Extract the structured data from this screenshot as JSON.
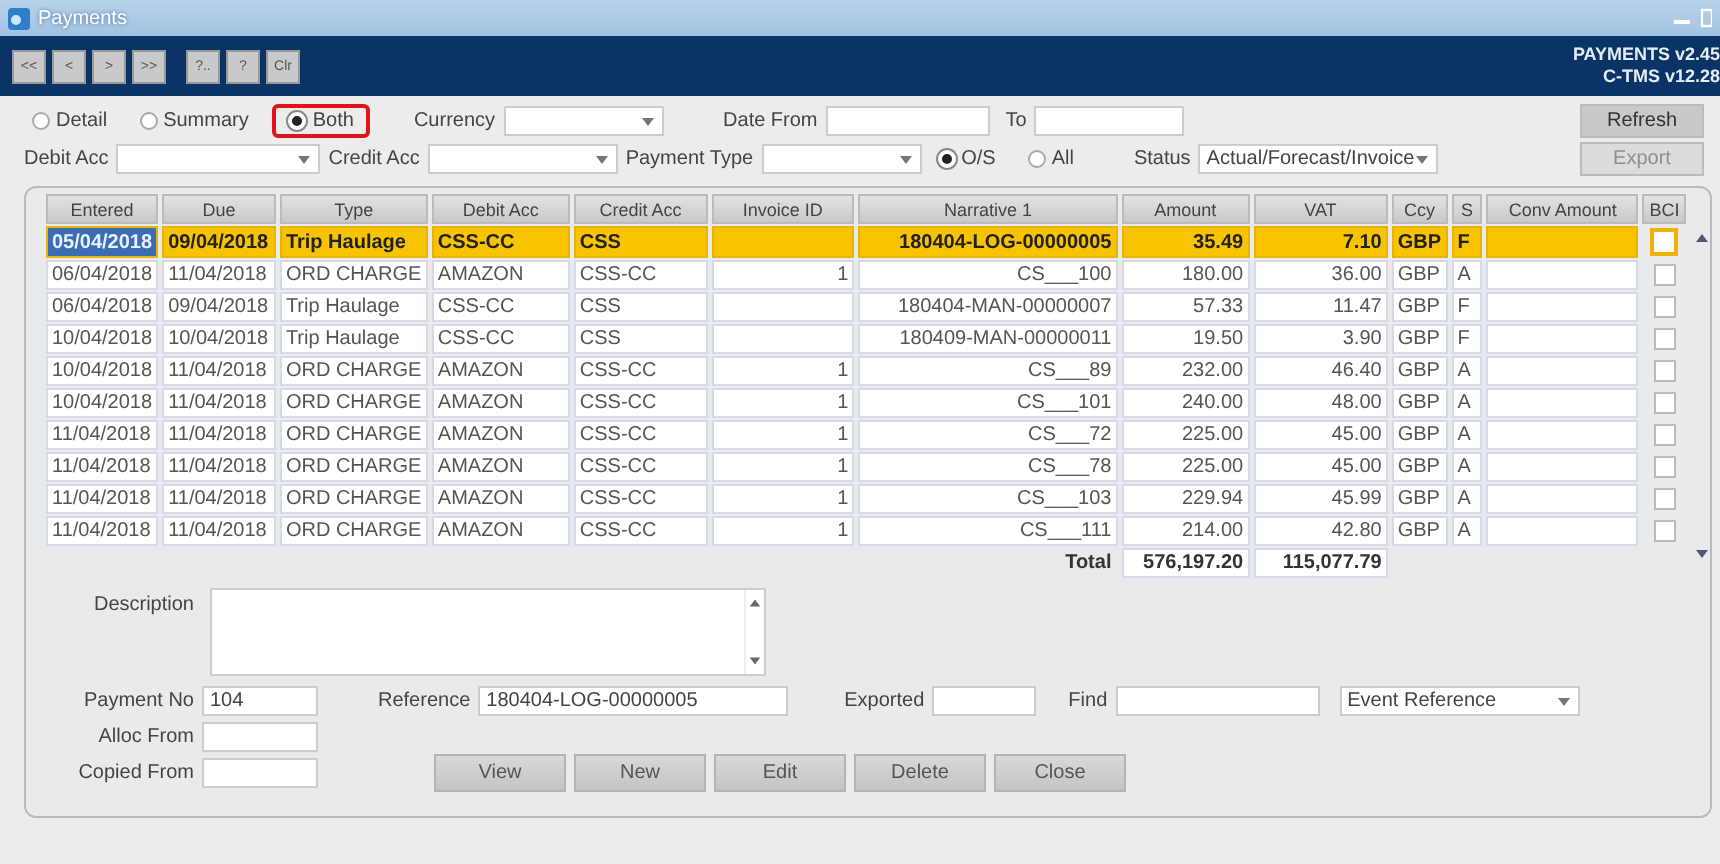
{
  "window": {
    "title": "Payments",
    "version_lines": [
      "PAYMENTS v2.45",
      "C-TMS v12.28"
    ]
  },
  "toolbar": {
    "buttons": [
      "<<",
      "<",
      ">",
      ">>",
      "?..",
      "?",
      "Clr"
    ]
  },
  "filters": {
    "view_modes": [
      {
        "label": "Detail",
        "selected": false,
        "highlighted": false
      },
      {
        "label": "Summary",
        "selected": false,
        "highlighted": false
      },
      {
        "label": "Both",
        "selected": true,
        "highlighted": true
      }
    ],
    "currency": {
      "label": "Currency"
    },
    "date_from": {
      "label": "Date From"
    },
    "date_to": {
      "label": "To"
    },
    "debit_acc": {
      "label": "Debit Acc"
    },
    "credit_acc": {
      "label": "Credit Acc"
    },
    "payment_type": {
      "label": "Payment Type"
    },
    "outstanding": [
      {
        "label": "O/S",
        "selected": true
      },
      {
        "label": "All",
        "selected": false
      }
    ],
    "status": {
      "label": "Status",
      "value": "Actual/Forecast/Invoice"
    },
    "buttons": [
      {
        "label": "Refresh",
        "disabled": false
      },
      {
        "label": "Export",
        "disabled": true
      }
    ]
  },
  "table": {
    "columns": [
      "Entered",
      "Due",
      "Type",
      "Debit Acc",
      "Credit Acc",
      "Invoice ID",
      "Narrative 1",
      "Amount",
      "VAT",
      "Ccy",
      "S",
      "Conv Amount",
      "BCI"
    ],
    "rows": [
      {
        "selected": true,
        "entered": "05/04/2018",
        "due": "09/04/2018",
        "type": "Trip Haulage",
        "debit_acc": "CSS-CC",
        "credit_acc": "CSS",
        "narrative": "180404-LOG-00000005",
        "amount": "35.49",
        "vat": "7.10",
        "ccy": "GBP",
        "s": "F",
        "bci_checked": false
      },
      {
        "selected": false,
        "entered": "06/04/2018",
        "due": "11/04/2018",
        "type": "ORD CHARGE",
        "debit_acc": "AMAZON",
        "credit_acc": "CSS-CC",
        "invoice_id": "1",
        "narrative": "CS___100",
        "amount": "180.00",
        "vat": "36.00",
        "ccy": "GBP",
        "s": "A",
        "bci_checked": false
      },
      {
        "selected": false,
        "entered": "06/04/2018",
        "due": "09/04/2018",
        "type": "Trip Haulage",
        "debit_acc": "CSS-CC",
        "credit_acc": "CSS",
        "narrative": "180404-MAN-00000007",
        "amount": "57.33",
        "vat": "11.47",
        "ccy": "GBP",
        "s": "F",
        "bci_checked": false
      },
      {
        "selected": false,
        "entered": "10/04/2018",
        "due": "10/04/2018",
        "type": "Trip Haulage",
        "debit_acc": "CSS-CC",
        "credit_acc": "CSS",
        "narrative": "180409-MAN-00000011",
        "amount": "19.50",
        "vat": "3.90",
        "ccy": "GBP",
        "s": "F",
        "bci_checked": false
      },
      {
        "selected": false,
        "entered": "10/04/2018",
        "due": "11/04/2018",
        "type": "ORD CHARGE",
        "debit_acc": "AMAZON",
        "credit_acc": "CSS-CC",
        "invoice_id": "1",
        "narrative": "CS___89",
        "amount": "232.00",
        "vat": "46.40",
        "ccy": "GBP",
        "s": "A",
        "bci_checked": false
      },
      {
        "selected": false,
        "entered": "10/04/2018",
        "due": "11/04/2018",
        "type": "ORD CHARGE",
        "debit_acc": "AMAZON",
        "credit_acc": "CSS-CC",
        "invoice_id": "1",
        "narrative": "CS___101",
        "amount": "240.00",
        "vat": "48.00",
        "ccy": "GBP",
        "s": "A",
        "bci_checked": false
      },
      {
        "selected": false,
        "entered": "11/04/2018",
        "due": "11/04/2018",
        "type": "ORD CHARGE",
        "debit_acc": "AMAZON",
        "credit_acc": "CSS-CC",
        "invoice_id": "1",
        "narrative": "CS___72",
        "amount": "225.00",
        "vat": "45.00",
        "ccy": "GBP",
        "s": "A",
        "bci_checked": false
      },
      {
        "selected": false,
        "entered": "11/04/2018",
        "due": "11/04/2018",
        "type": "ORD CHARGE",
        "debit_acc": "AMAZON",
        "credit_acc": "CSS-CC",
        "invoice_id": "1",
        "narrative": "CS___78",
        "amount": "225.00",
        "vat": "45.00",
        "ccy": "GBP",
        "s": "A",
        "bci_checked": false
      },
      {
        "selected": false,
        "entered": "11/04/2018",
        "due": "11/04/2018",
        "type": "ORD CHARGE",
        "debit_acc": "AMAZON",
        "credit_acc": "CSS-CC",
        "invoice_id": "1",
        "narrative": "CS___103",
        "amount": "229.94",
        "vat": "45.99",
        "ccy": "GBP",
        "s": "A",
        "bci_checked": false
      },
      {
        "selected": false,
        "entered": "11/04/2018",
        "due": "11/04/2018",
        "type": "ORD CHARGE",
        "debit_acc": "AMAZON",
        "credit_acc": "CSS-CC",
        "invoice_id": "1",
        "narrative": "CS___111",
        "amount": "214.00",
        "vat": "42.80",
        "ccy": "GBP",
        "s": "A",
        "bci_checked": false
      }
    ],
    "totals": {
      "label": "Total",
      "amount": "576,197.20",
      "vat": "115,077.79"
    }
  },
  "detail": {
    "description": {
      "label": "Description"
    },
    "payment_no": {
      "label": "Payment No",
      "value": "104"
    },
    "reference": {
      "label": "Reference",
      "value": "180404-LOG-00000005"
    },
    "exported": {
      "label": "Exported"
    },
    "find": {
      "label": "Find"
    },
    "find_by": {
      "value": "Event Reference"
    },
    "alloc_from": {
      "label": "Alloc From"
    },
    "copied_from": {
      "label": "Copied From"
    }
  },
  "buttons": [
    "View",
    "New",
    "Edit",
    "Delete",
    "Close"
  ]
}
